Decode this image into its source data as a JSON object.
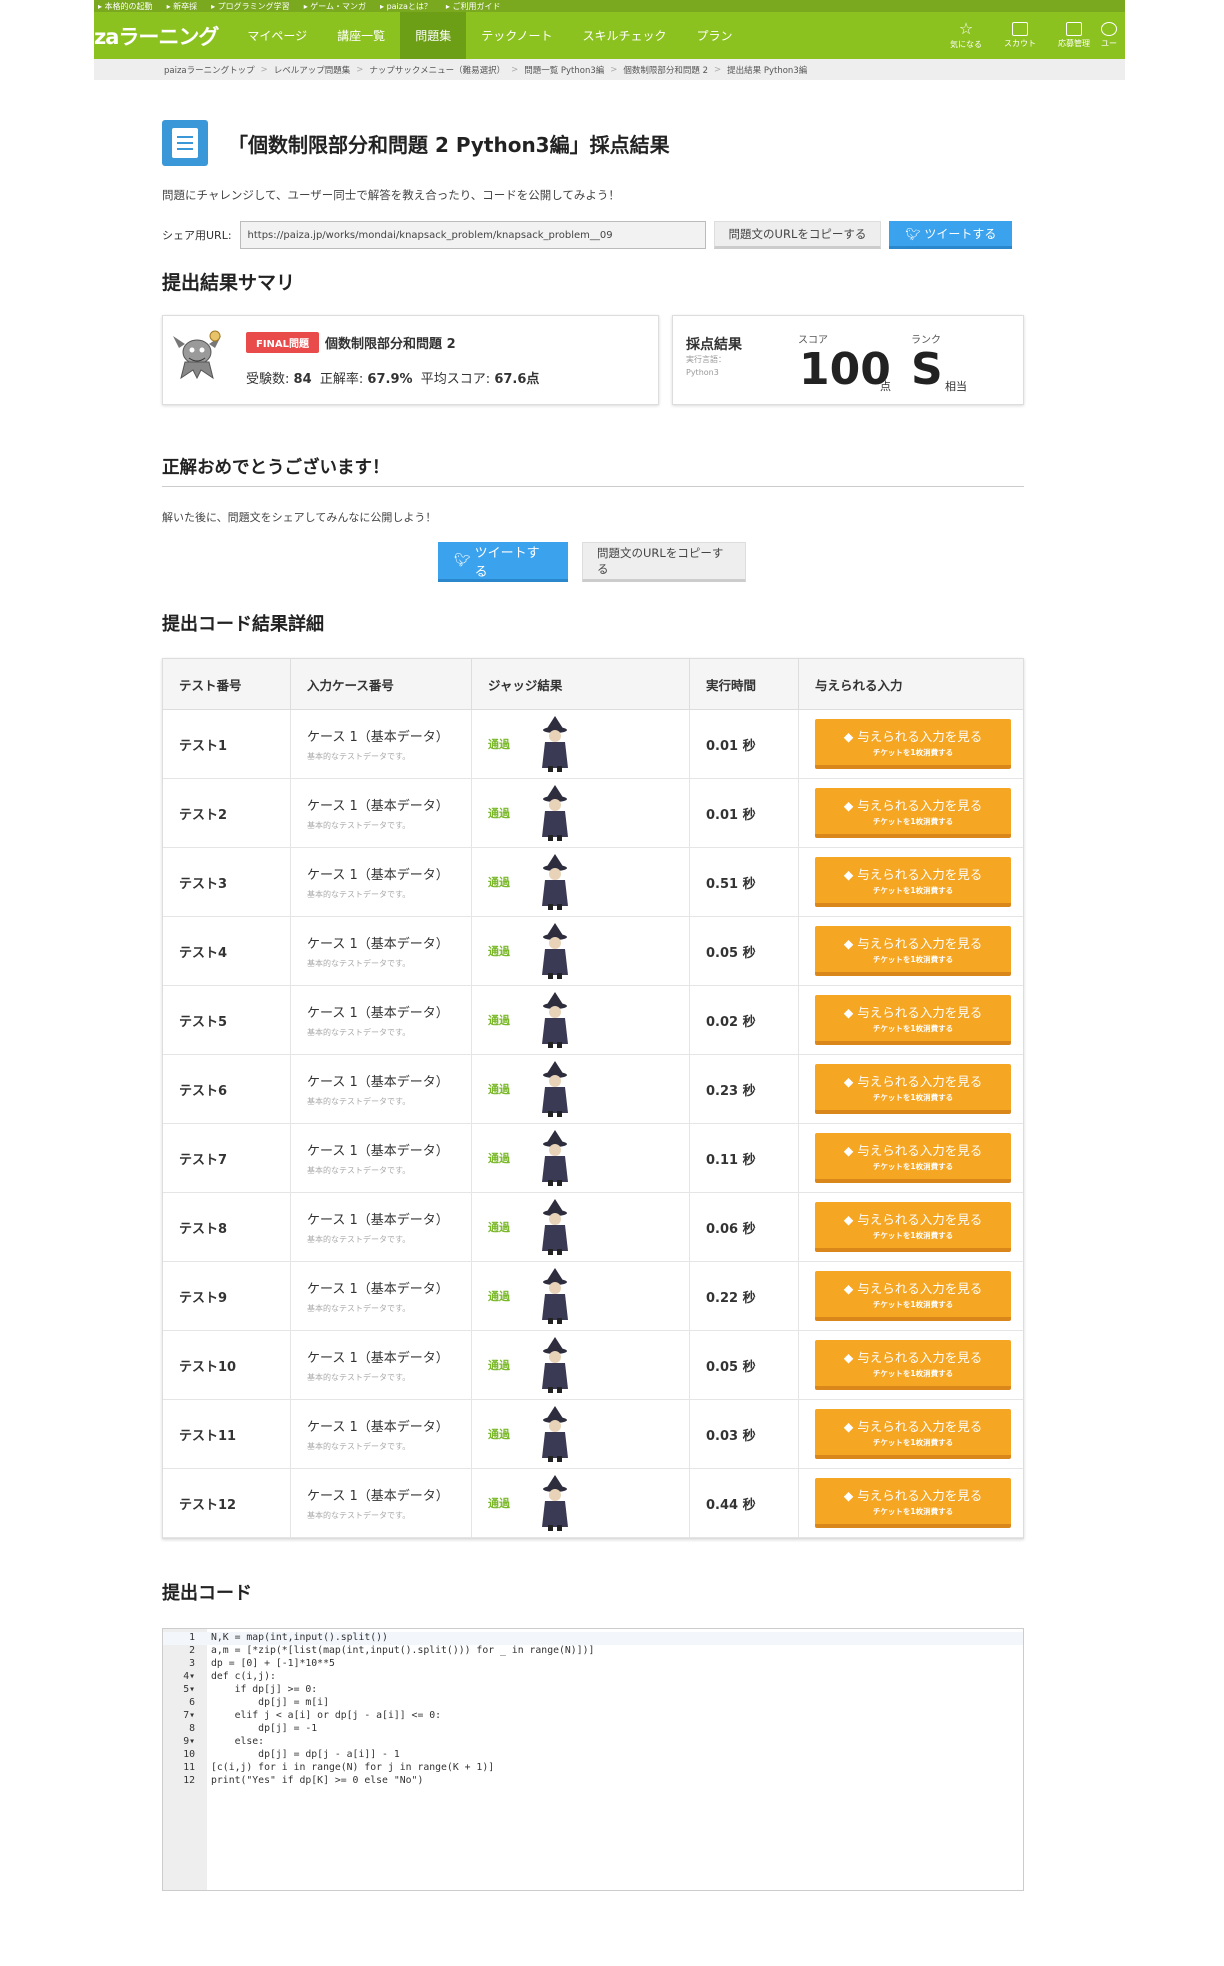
{
  "topbar": {
    "items": [
      "▸ 本格的の起動",
      "▸ 新卒採",
      "▸ プログラミング学習",
      "▸ ゲーム・マンガ",
      "▸ paizaとは？",
      "▸ ご利用ガイド"
    ]
  },
  "nav": {
    "logo": "zaラーニング",
    "items": [
      "マイページ",
      "講座一覧",
      "問題集",
      "テックノート",
      "スキルチェック",
      "プラン"
    ],
    "right": [
      "気になる",
      "スカウト",
      "応募管理",
      "ユー"
    ]
  },
  "breadcrumb": [
    "paizaラーニングトップ",
    "レベルアップ問題集",
    "ナップサックメニュー（難易選択）",
    "問題一覧 Python3編",
    "個数制限部分和問題 2",
    "提出結果 Python3編"
  ],
  "page": {
    "title": "「個数制限部分和問題 2 Python3編」採点結果",
    "intro": "問題にチャレンジして、ユーザー同士で解答を教え合ったり、コードを公開してみよう！",
    "share_label": "シェア用URL:",
    "share_url": "https://paiza.jp/works/mondai/knapsack_problem/knapsack_problem__09",
    "copy_label": "問題文のURLをコピーする",
    "tweet_label": "ツイートする"
  },
  "summary": {
    "heading": "提出結果サマリ",
    "badge": "FINAL問題",
    "problem_name": "個数制限部分和問題 2",
    "examinees_label": "受験数:",
    "examinees": "84",
    "accuracy_label": "正解率:",
    "accuracy": "67.9%",
    "avg_label": "平均スコア:",
    "avg": "67.6点",
    "result_title": "採点結果",
    "lang_label": "実行言語：",
    "lang": "Python3",
    "score_label": "スコア",
    "score": "100",
    "score_unit": "点",
    "rank_label": "ランク",
    "rank": "S",
    "rank_unit": "相当"
  },
  "congrats": {
    "heading": "正解おめでとうございます！",
    "text": "解いた後に、問題文をシェアしてみんなに公開しよう！",
    "tweet_label": "ツイートする",
    "copy_label": "問題文のURLをコピーする"
  },
  "details": {
    "heading": "提出コード結果詳細",
    "columns": [
      "テスト番号",
      "入力ケース番号",
      "ジャッジ結果",
      "実行時間",
      "与えられる入力"
    ],
    "case_label": "ケース 1（基本データ）",
    "case_desc": "基本的なテストデータです。",
    "pass_label": "通過",
    "view_label": "与えられる入力を見る",
    "view_sub": "チケットを1枚消費する",
    "rows": [
      {
        "test": "テスト1",
        "time": "0.01 秒"
      },
      {
        "test": "テスト2",
        "time": "0.01 秒"
      },
      {
        "test": "テスト3",
        "time": "0.51 秒"
      },
      {
        "test": "テスト4",
        "time": "0.05 秒"
      },
      {
        "test": "テスト5",
        "time": "0.02 秒"
      },
      {
        "test": "テスト6",
        "time": "0.23 秒"
      },
      {
        "test": "テスト7",
        "time": "0.11 秒"
      },
      {
        "test": "テスト8",
        "time": "0.06 秒"
      },
      {
        "test": "テスト9",
        "time": "0.22 秒"
      },
      {
        "test": "テスト10",
        "time": "0.05 秒"
      },
      {
        "test": "テスト11",
        "time": "0.03 秒"
      },
      {
        "test": "テスト12",
        "time": "0.44 秒"
      }
    ]
  },
  "code": {
    "heading": "提出コード",
    "lines": [
      "N,K = map(int,input().split())",
      "a,m = [*zip(*[list(map(int,input().split())) for _ in range(N)])]",
      "dp = [0] + [-1]*10**5",
      "def c(i,j):",
      "    if dp[j] >= 0:",
      "        dp[j] = m[i]",
      "    elif j < a[i] or dp[j - a[i]] <= 0:",
      "        dp[j] = -1",
      "    else:",
      "        dp[j] = dp[j - a[i]] - 1",
      "[c(i,j) for i in range(N) for j in range(K + 1)]",
      "print(\"Yes\" if dp[K] >= 0 else \"No\")"
    ],
    "fold_lines": [
      4,
      5,
      7,
      9
    ]
  },
  "colors": {
    "nav": "#8cc21f",
    "orange": "#f5a623",
    "twitter": "#3ba2ee",
    "pass": "#7ab82a",
    "badge": "#e94b4b"
  }
}
